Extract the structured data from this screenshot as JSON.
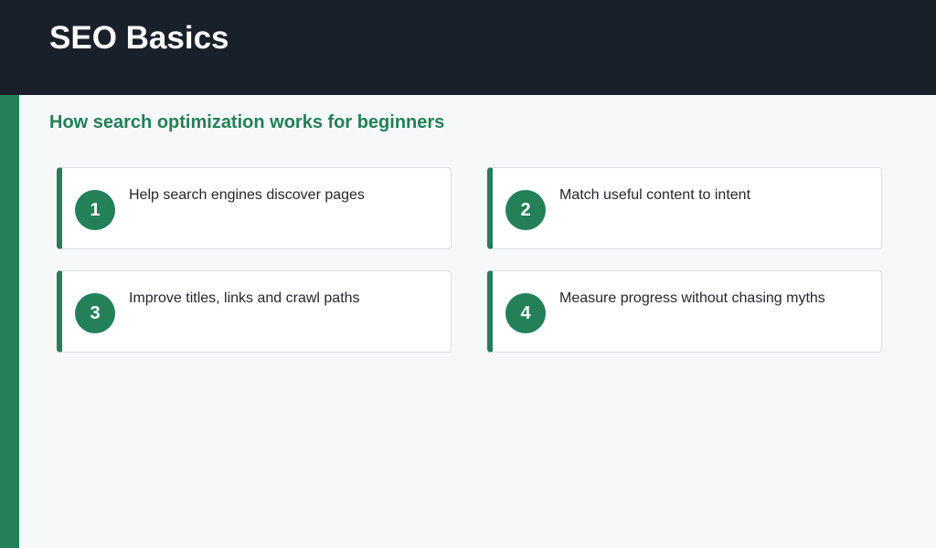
{
  "header": {
    "title": "SEO Basics"
  },
  "main": {
    "subtitle": "How search optimization works for beginners",
    "cards": [
      {
        "number": "1",
        "text": "Help search engines discover pages"
      },
      {
        "number": "2",
        "text": "Match useful content to intent"
      },
      {
        "number": "3",
        "text": "Improve titles, links and crawl paths"
      },
      {
        "number": "4",
        "text": "Measure progress without chasing myths"
      }
    ]
  },
  "colors": {
    "accent": "#238058",
    "header_background": "#1a202a",
    "page_background": "#f7f8fa"
  }
}
